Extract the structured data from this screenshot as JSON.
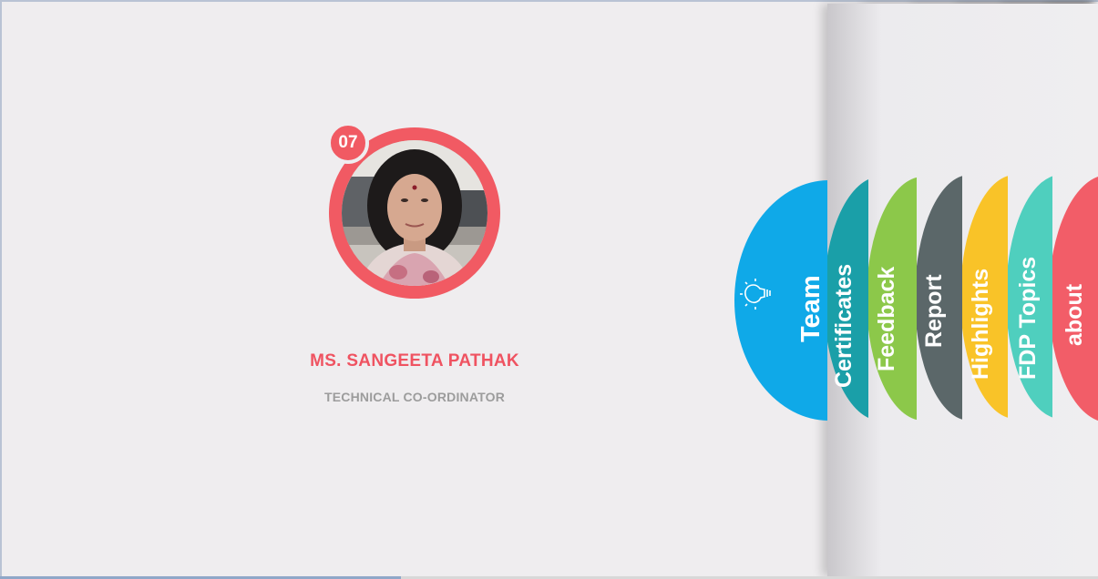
{
  "profile": {
    "number": "07",
    "name": "MS. SANGEETA PATHAK",
    "role": "TECHNICAL CO-ORDINATOR"
  },
  "tabs": [
    {
      "label": "Team",
      "color": "#0fa9e8",
      "icon": "lightbulb-icon"
    },
    {
      "label": "Certificates",
      "color": "#1a9fa8"
    },
    {
      "label": "Feedback",
      "color": "#8cc84a"
    },
    {
      "label": "Report",
      "color": "#5b6769"
    },
    {
      "label": "Highlights",
      "color": "#f9c328"
    },
    {
      "label": "FDP Topics",
      "color": "#4fcfbe"
    },
    {
      "label": "about",
      "color": "#f25d68"
    }
  ],
  "colors": {
    "accent": "#f15a63",
    "background": "#efedef",
    "role_text": "#9c9c9c"
  }
}
